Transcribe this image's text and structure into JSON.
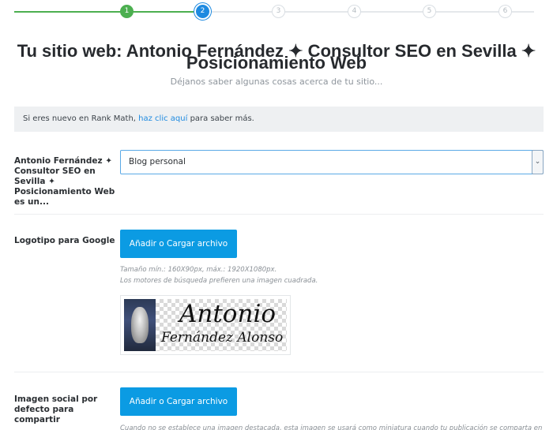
{
  "stepper": {
    "steps": [
      "1",
      "2",
      "3",
      "4",
      "5",
      "6"
    ],
    "current": 2
  },
  "heading": {
    "title_line1": "Tu sitio web: Antonio Fernández ✦ Consultor SEO en Sevilla ✦",
    "title_line2": "Posicionamiento Web",
    "subtitle": "Déjanos saber algunas cosas acerca de tu sitio..."
  },
  "notice": {
    "prefix": "Si eres nuevo en Rank Math,",
    "link": "haz clic aquí",
    "suffix": "para saber más."
  },
  "site_type": {
    "label": "Antonio Fernández ✦ Consultor SEO en Sevilla ✦ Posicionamiento Web es un...",
    "selected": "Blog personal",
    "arrow": "⌄"
  },
  "logo": {
    "label": "Logotipo para Google",
    "button": "Añadir o Cargar archivo",
    "hint1": "Tamaño mín.: 160X90px, máx.: 1920X1080px.",
    "hint2": "Los motores de búsqueda prefieren una imagen cuadrada.",
    "image_text1": "Antonio",
    "image_text2": "Fernández Alonso"
  },
  "social": {
    "label": "Imagen social por defecto para compartir",
    "button": "Añadir o Cargar archivo",
    "hint": "Cuando no se establece una imagen destacada, esta imagen se usará como miniatura cuando tu publicación se comparta en"
  },
  "colors": {
    "done": "#4caf50",
    "active": "#1e8ae0",
    "button": "#0b9be3"
  }
}
